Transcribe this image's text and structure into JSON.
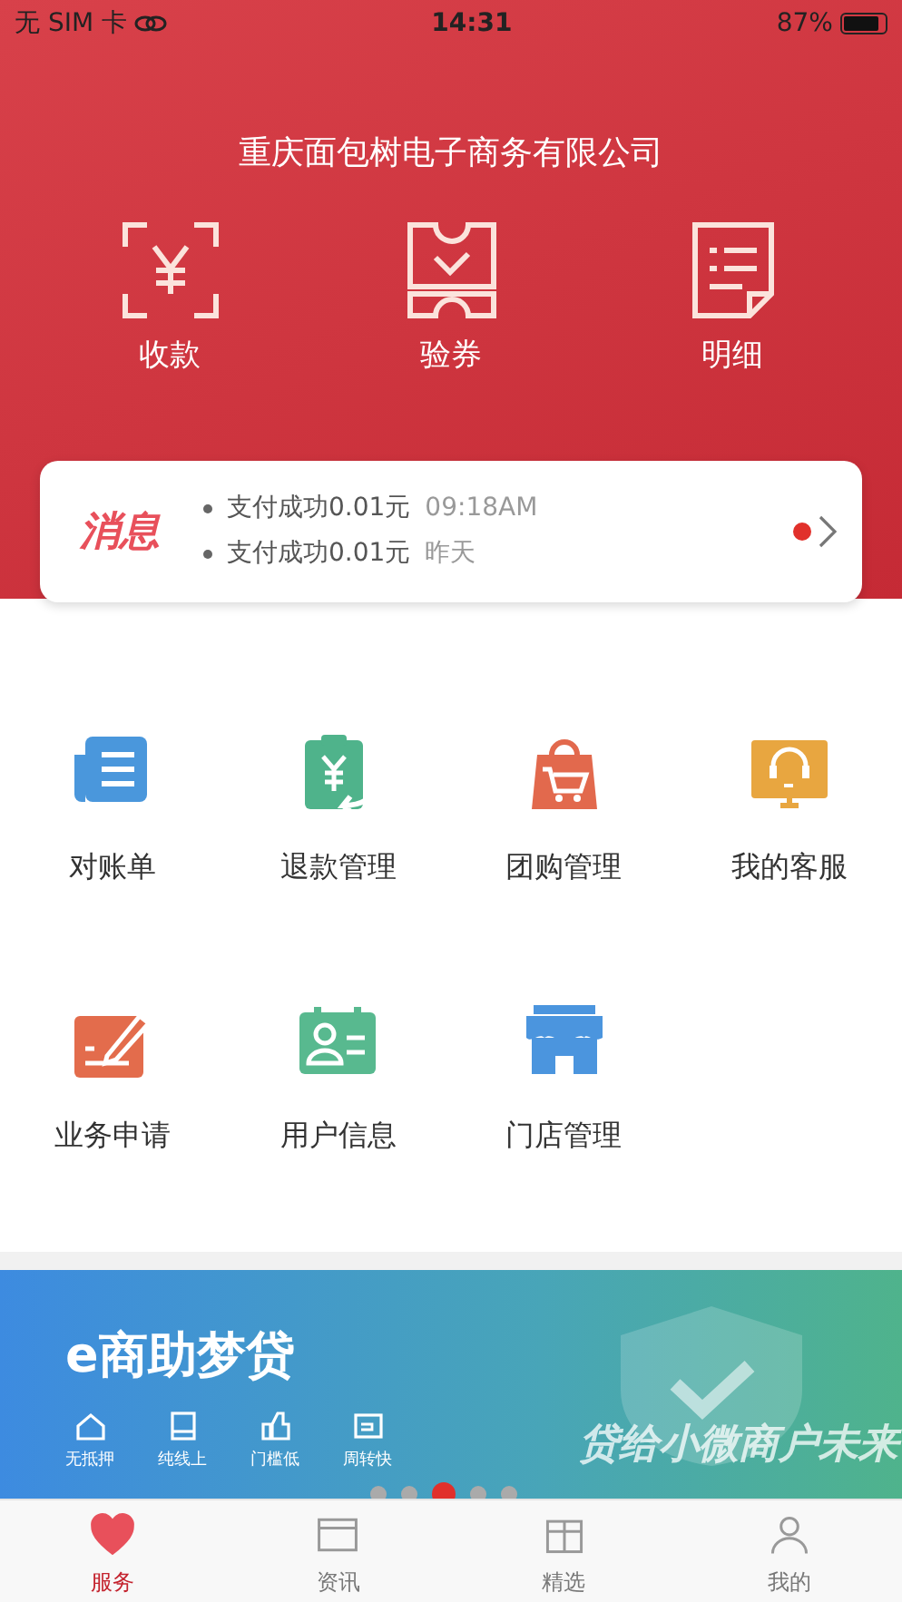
{
  "status_bar": {
    "carrier": "无 SIM 卡",
    "time": "14:31",
    "battery": "87%"
  },
  "header": {
    "title": "重庆面包树电子商务有限公司"
  },
  "actions": [
    {
      "kind": "scan",
      "label": "收款"
    },
    {
      "kind": "ticket",
      "label": "验券"
    },
    {
      "kind": "list",
      "label": "明细"
    }
  ],
  "messages": {
    "badge": "消息",
    "unread": true,
    "items": [
      {
        "text": "支付成功0.01元",
        "time": "09:18AM"
      },
      {
        "text": "支付成功0.01元",
        "time": "昨天"
      }
    ]
  },
  "services": [
    {
      "kind": "statement",
      "label": "对账单",
      "color": "#4a97dc"
    },
    {
      "kind": "refund",
      "label": "退款管理",
      "color": "#4fb38b"
    },
    {
      "kind": "group",
      "label": "团购管理",
      "color": "#e2694d"
    },
    {
      "kind": "support",
      "label": "我的客服",
      "color": "#e8a640"
    },
    {
      "kind": "apply",
      "label": "业务申请",
      "color": "#e36c4c"
    },
    {
      "kind": "user",
      "label": "用户信息",
      "color": "#58b98f"
    },
    {
      "kind": "store",
      "label": "门店管理",
      "color": "#4b95de"
    }
  ],
  "banner": {
    "title": "e商助梦贷",
    "features": [
      "无抵押",
      "纯线上",
      "门槛低",
      "周转快"
    ],
    "slogan": "贷给小微商户未来",
    "slides": [
      {
        "selected": false
      },
      {
        "selected": false
      },
      {
        "selected": true
      },
      {
        "selected": false
      },
      {
        "selected": false
      }
    ]
  },
  "tabs": [
    {
      "kind": "heart",
      "label": "服务",
      "selected": true
    },
    {
      "kind": "card",
      "label": "资讯",
      "selected": false
    },
    {
      "kind": "box",
      "label": "精选",
      "selected": false
    },
    {
      "kind": "person",
      "label": "我的",
      "selected": false
    }
  ]
}
